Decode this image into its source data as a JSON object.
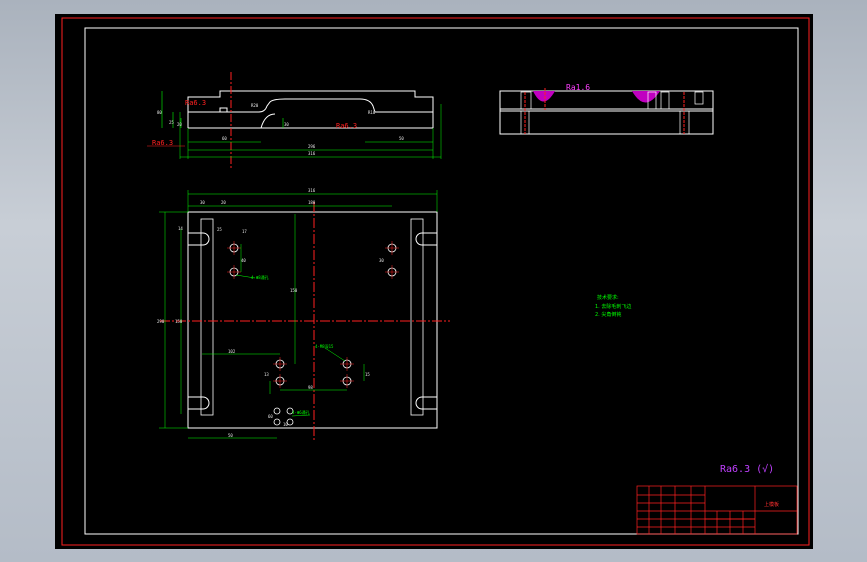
{
  "drawing": {
    "roughness_marks": {
      "top_left_a": "Ra6.3",
      "top_left_b": "Ra6.3",
      "top_middle": "Ra6.3",
      "side_view": "Ra1.6",
      "general": "Ra6.3 (√)"
    },
    "top_view_dims": {
      "h80": "80",
      "h25": "25",
      "h20": "20",
      "r20": "R20",
      "d30": "30",
      "r10": "R10",
      "w60": "60",
      "w50": "50",
      "w296": "296",
      "w316": "316"
    },
    "plan_view_dims": {
      "w316": "316",
      "w30": "30",
      "w20": "20",
      "w180": "180",
      "h290": "290",
      "h150": "150",
      "h14": "14",
      "h25": "25",
      "h17": "17",
      "h40": "40",
      "h30": "30",
      "h150b": "150",
      "w102": "102",
      "h13": "13",
      "w98": "98",
      "w50": "50",
      "h15": "15",
      "w60": "60",
      "d10": "10"
    },
    "hole_callouts": {
      "a": "4-Φ8通孔",
      "b": "4-M8深15",
      "c": "4-Φ6通孔"
    },
    "tech_notes": {
      "heading": "技术要求:",
      "line1": "1. 去除毛刺飞边",
      "line2": "2. 尖角倒钝"
    },
    "title_block": {
      "part_name": "上模板"
    }
  }
}
